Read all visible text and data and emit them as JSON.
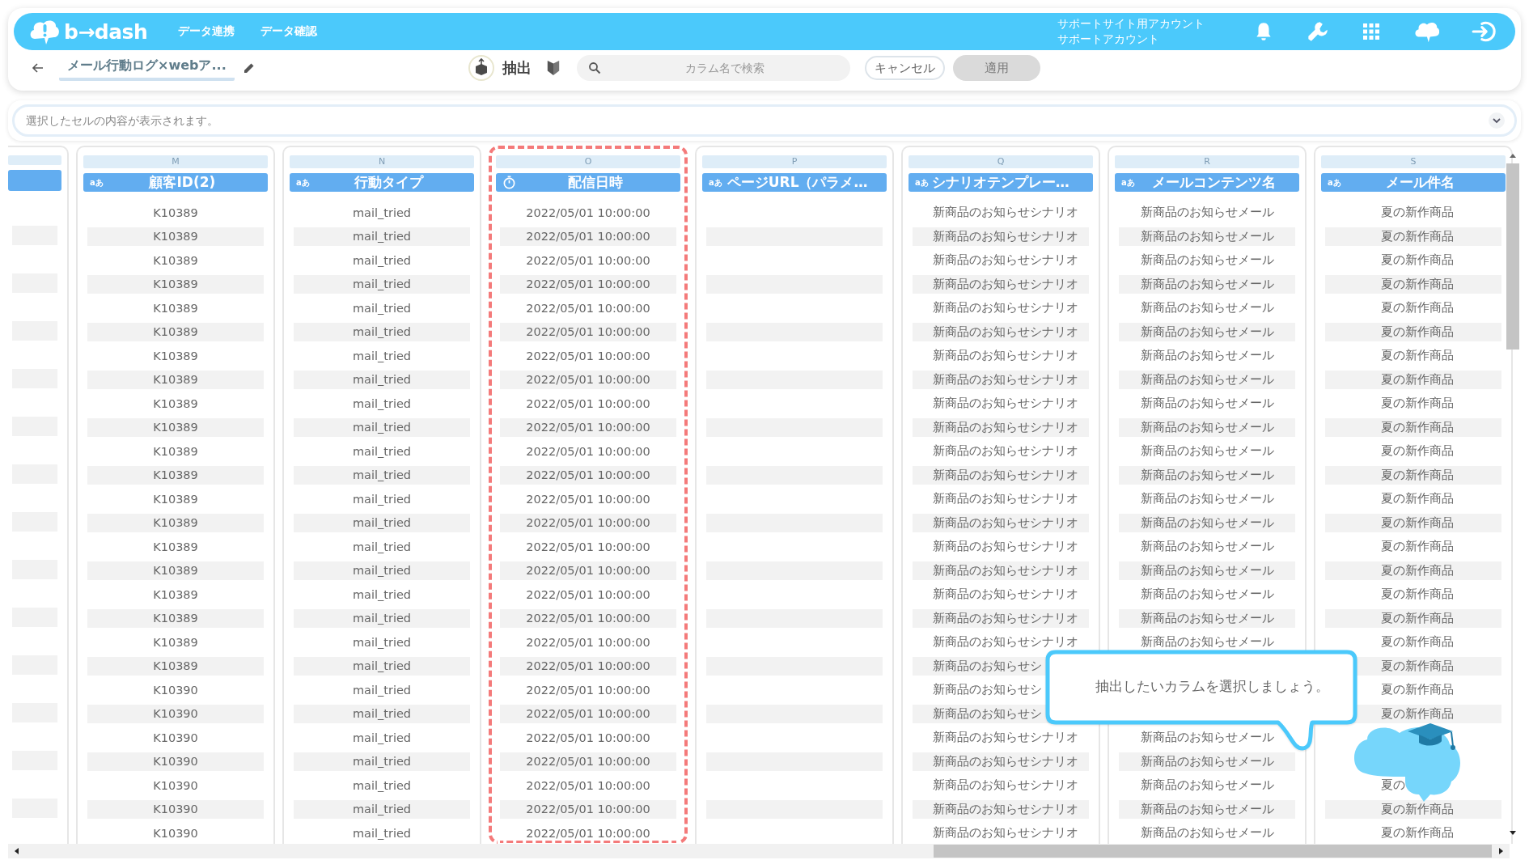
{
  "header": {
    "logo": "b→dash",
    "nav": [
      "データ連携",
      "データ確認"
    ],
    "account": [
      "サポートサイト用アカウント",
      "サポートアカウント"
    ]
  },
  "toolbar": {
    "title": "メール行動ログ×webア...",
    "extract": "抽出",
    "search": {
      "placeholder": "カラム名で検索"
    },
    "cancel": "キャンセル",
    "apply": {
      "label": "適用",
      "disabled": true
    }
  },
  "cell_viewer": {
    "placeholder": "選択したセルの内容が表示されます。"
  },
  "columns": [
    {
      "letter": "M",
      "name": "顧客ID(2)",
      "kind": "text",
      "type_label": "aあ",
      "highlighted": false,
      "cells": [
        "K10389",
        "K10389",
        "K10389",
        "K10389",
        "K10389",
        "K10389",
        "K10389",
        "K10389",
        "K10389",
        "K10389",
        "K10389",
        "K10389",
        "K10389",
        "K10389",
        "K10389",
        "K10389",
        "K10389",
        "K10389",
        "K10389",
        "K10389",
        "K10390",
        "K10390",
        "K10390",
        "K10390",
        "K10390",
        "K10390",
        "K10390"
      ]
    },
    {
      "letter": "N",
      "name": "行動タイプ",
      "kind": "text",
      "type_label": "aあ",
      "highlighted": false,
      "cells": [
        "mail_tried",
        "mail_tried",
        "mail_tried",
        "mail_tried",
        "mail_tried",
        "mail_tried",
        "mail_tried",
        "mail_tried",
        "mail_tried",
        "mail_tried",
        "mail_tried",
        "mail_tried",
        "mail_tried",
        "mail_tried",
        "mail_tried",
        "mail_tried",
        "mail_tried",
        "mail_tried",
        "mail_tried",
        "mail_tried",
        "mail_tried",
        "mail_tried",
        "mail_tried",
        "mail_tried",
        "mail_tried",
        "mail_tried",
        "mail_tried"
      ]
    },
    {
      "letter": "O",
      "name": "配信日時",
      "kind": "datetime",
      "highlighted": true,
      "cells": [
        "2022/05/01 10:00:00",
        "2022/05/01 10:00:00",
        "2022/05/01 10:00:00",
        "2022/05/01 10:00:00",
        "2022/05/01 10:00:00",
        "2022/05/01 10:00:00",
        "2022/05/01 10:00:00",
        "2022/05/01 10:00:00",
        "2022/05/01 10:00:00",
        "2022/05/01 10:00:00",
        "2022/05/01 10:00:00",
        "2022/05/01 10:00:00",
        "2022/05/01 10:00:00",
        "2022/05/01 10:00:00",
        "2022/05/01 10:00:00",
        "2022/05/01 10:00:00",
        "2022/05/01 10:00:00",
        "2022/05/01 10:00:00",
        "2022/05/01 10:00:00",
        "2022/05/01 10:00:00",
        "2022/05/01 10:00:00",
        "2022/05/01 10:00:00",
        "2022/05/01 10:00:00",
        "2022/05/01 10:00:00",
        "2022/05/01 10:00:00",
        "2022/05/01 10:00:00",
        "2022/05/01 10:00:00"
      ]
    },
    {
      "letter": "P",
      "name": "ページURL（パラメ…",
      "kind": "text",
      "type_label": "aあ",
      "highlighted": false
    },
    {
      "letter": "Q",
      "name": "シナリオテンプレー…",
      "kind": "text",
      "type_label": "aあ",
      "highlighted": false,
      "cells": [
        "新商品のお知らせシナリオ",
        "新商品のお知らせシナリオ",
        "新商品のお知らせシナリオ",
        "新商品のお知らせシナリオ",
        "新商品のお知らせシナリオ",
        "新商品のお知らせシナリオ",
        "新商品のお知らせシナリオ",
        "新商品のお知らせシナリオ",
        "新商品のお知らせシナリオ",
        "新商品のお知らせシナリオ",
        "新商品のお知らせシナリオ",
        "新商品のお知らせシナリオ",
        "新商品のお知らせシナリオ",
        "新商品のお知らせシナリオ",
        "新商品のお知らせシナリオ",
        "新商品のお知らせシナリオ",
        "新商品のお知らせシナリオ",
        "新商品のお知らせシナリオ",
        "新商品のお知らせシナリオ",
        "新商品のお知らせシ",
        "新商品のお知らせシ",
        "新商品のお知らせシ",
        "新商品のお知らせシナリオ",
        "新商品のお知らせシナリオ",
        "新商品のお知らせシナリオ",
        "新商品のお知らせシナリオ",
        "新商品のお知らせシナリオ"
      ]
    },
    {
      "letter": "R",
      "name": "メールコンテンツ名",
      "kind": "text",
      "type_label": "aあ",
      "highlighted": false,
      "cells": [
        "新商品のお知らせメール",
        "新商品のお知らせメール",
        "新商品のお知らせメール",
        "新商品のお知らせメール",
        "新商品のお知らせメール",
        "新商品のお知らせメール",
        "新商品のお知らせメール",
        "新商品のお知らせメール",
        "新商品のお知らせメール",
        "新商品のお知らせメール",
        "新商品のお知らせメール",
        "新商品のお知らせメール",
        "新商品のお知らせメール",
        "新商品のお知らせメール",
        "新商品のお知らせメール",
        "新商品のお知らせメール",
        "新商品のお知らせメール",
        "新商品のお知らせメール",
        "新商品のお知らせメール",
        null,
        null,
        null,
        "新商品のお知らせメール",
        "新商品のお知らせメール",
        "新商品のお知らせメール",
        "新商品のお知らせメール",
        "新商品のお知らせメール"
      ]
    },
    {
      "letter": "S",
      "name": "メール件名",
      "kind": "text",
      "type_label": "aあ",
      "highlighted": false,
      "cells": [
        "夏の新作商品",
        "夏の新作商品",
        "夏の新作商品",
        "夏の新作商品",
        "夏の新作商品",
        "夏の新作商品",
        "夏の新作商品",
        "夏の新作商品",
        "夏の新作商品",
        "夏の新作商品",
        "夏の新作商品",
        "夏の新作商品",
        "夏の新作商品",
        "夏の新作商品",
        "夏の新作商品",
        "夏の新作商品",
        "夏の新作商品",
        "夏の新作商品",
        "夏の新作商品",
        "夏の新作商品",
        "夏の新作商品",
        "夏の新作商品",
        null,
        null,
        "夏の",
        "夏の新作商品",
        "夏の新作商品"
      ]
    }
  ],
  "tooltip": {
    "text": "抽出したいカラムを選択しましょう。"
  }
}
